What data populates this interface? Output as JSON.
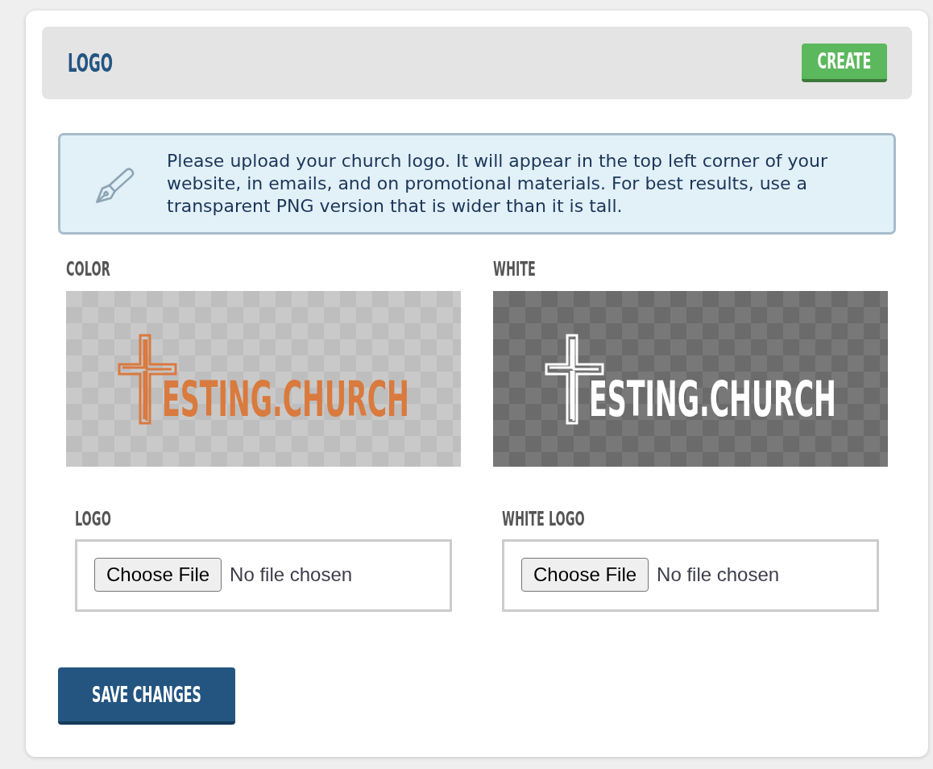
{
  "panel": {
    "title": "LOGO",
    "create_button": "CREATE"
  },
  "notice": {
    "text": "Please upload your church logo. It will appear in the top left corner of your website, in emails, and on promotional materials. For best results, use a transparent PNG version that is wider than it is tall."
  },
  "previews": [
    {
      "label": "COLOR",
      "kind": "light",
      "color": "#d97a3e",
      "logo_text": "ESTING.CHURCH"
    },
    {
      "label": "WHITE",
      "kind": "dark",
      "color": "#ffffff",
      "logo_text": "ESTING.CHURCH"
    }
  ],
  "uploads": [
    {
      "label": "LOGO",
      "button": "Choose File",
      "status": "No file chosen"
    },
    {
      "label": "WHITE LOGO",
      "button": "Choose File",
      "status": "No file chosen"
    }
  ],
  "save_button": "SAVE CHANGES"
}
